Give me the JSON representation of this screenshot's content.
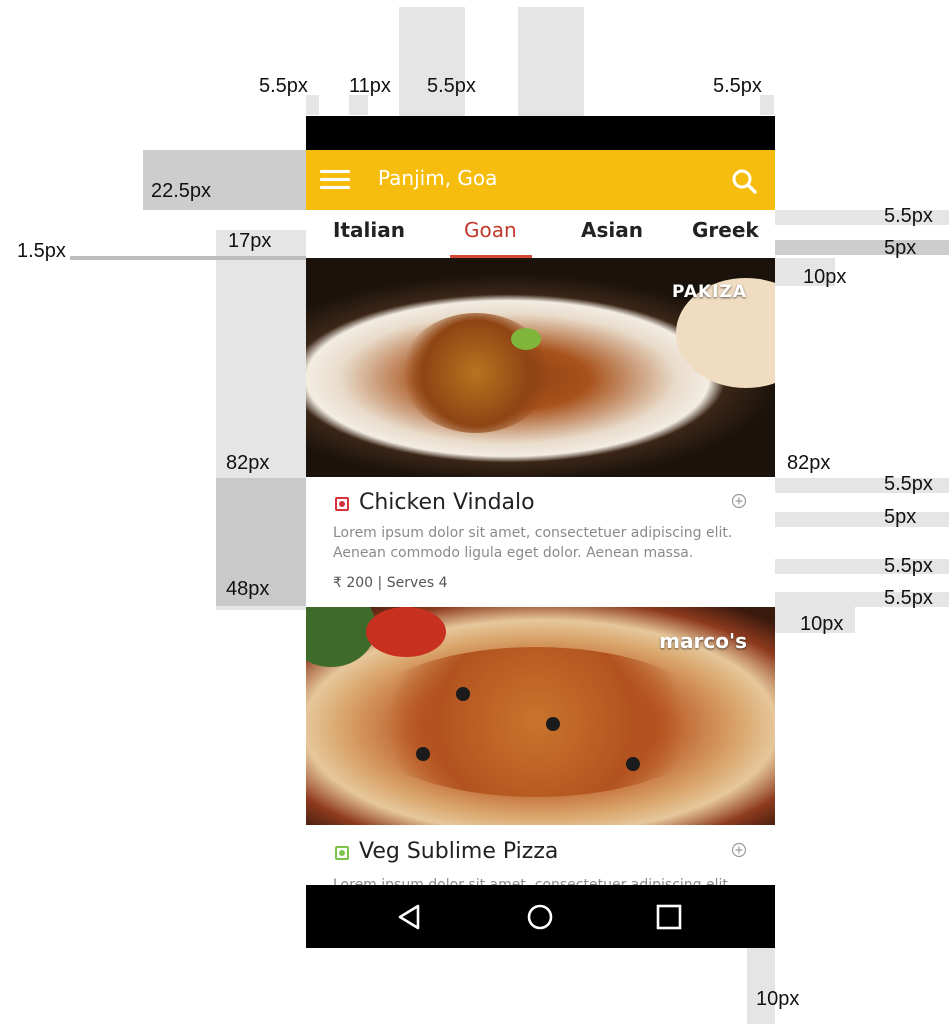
{
  "spec": {
    "labels": [
      "5.5px",
      "11px",
      "5.5px",
      "5.5px",
      "22.5px",
      "17px",
      "1.5px",
      "5.5px",
      "5px",
      "10px",
      "82px",
      "82px",
      "5.5px",
      "5px",
      "5.5px",
      "48px",
      "5.5px",
      "10px",
      "10px"
    ]
  },
  "app": {
    "title": "Panjim, Goa",
    "accent_color": "#f6bd0f",
    "menu_icon": "hamburger-menu-icon",
    "search_icon": "search-icon"
  },
  "tabs": [
    {
      "label": "Italian",
      "active": false
    },
    {
      "label": "Goan",
      "active": true
    },
    {
      "label": "Asian",
      "active": false
    },
    {
      "label": "Greek",
      "active": false
    }
  ],
  "tab_indicator_color": "#d64a35",
  "cards": [
    {
      "brand": "PAKIZA",
      "name": "Chicken Vindalo",
      "type": "non-veg",
      "type_color": "#d6303e",
      "description": "Lorem ipsum dolor sit amet, consectetuer adipiscing elit. Aenean commodo ligula eget dolor. Aenean massa.",
      "meta": "₹ 200  |  Serves 4"
    },
    {
      "brand": "marco's",
      "name": "Veg Sublime Pizza",
      "type": "veg",
      "type_color": "#7cc34a",
      "description": "Lorem ipsum dolor sit amet, consectetuer adipiscing elit."
    }
  ],
  "nav": {
    "back_icon": "back-triangle-icon",
    "home_icon": "home-circle-icon",
    "recents_icon": "recents-square-icon"
  }
}
